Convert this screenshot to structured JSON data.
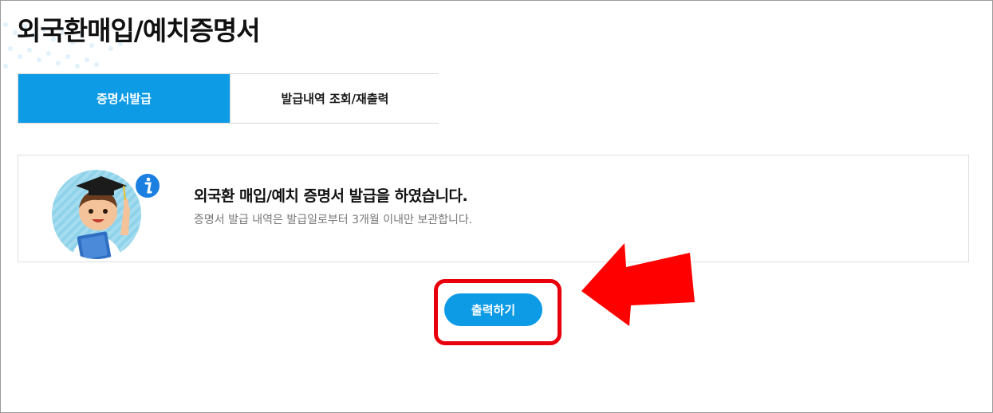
{
  "page": {
    "title": "외국환매입/예치증명서"
  },
  "tabs": [
    {
      "label": "증명서발급",
      "active": true
    },
    {
      "label": "발급내역 조회/재출력",
      "active": false
    }
  ],
  "notice": {
    "icon": "info-icon",
    "title": "외국환 매입/예치 증명서 발급을 하였습니다.",
    "subtitle": "증명서 발급 내역은 발급일로부터 3개월 이내만 보관합니다."
  },
  "actions": {
    "print_label": "출력하기"
  },
  "colors": {
    "accent": "#0d9be6",
    "highlight": "#e8000c"
  }
}
